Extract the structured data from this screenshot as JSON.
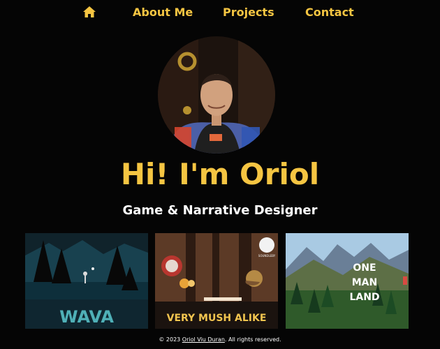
{
  "nav": {
    "home_icon": "home-icon",
    "about": "About Me",
    "projects": "Projects",
    "contact": "Contact"
  },
  "hero": {
    "title": "Hi! I'm Oriol",
    "subtitle": "Game & Narrative Designer"
  },
  "projects": [
    {
      "title": "WAVA"
    },
    {
      "title": "VERY MUSH ALIKE",
      "badge_line": "SOUNDLEBY"
    },
    {
      "title_line1": "ONE",
      "title_line2": "MAN",
      "title_line3": "LAND"
    }
  ],
  "footer": {
    "prefix": "© 2023 ",
    "link": "Oriol Viu Duran",
    "suffix": ". All rights reserved."
  },
  "colors": {
    "accent": "#f5c542",
    "background": "#050505"
  }
}
